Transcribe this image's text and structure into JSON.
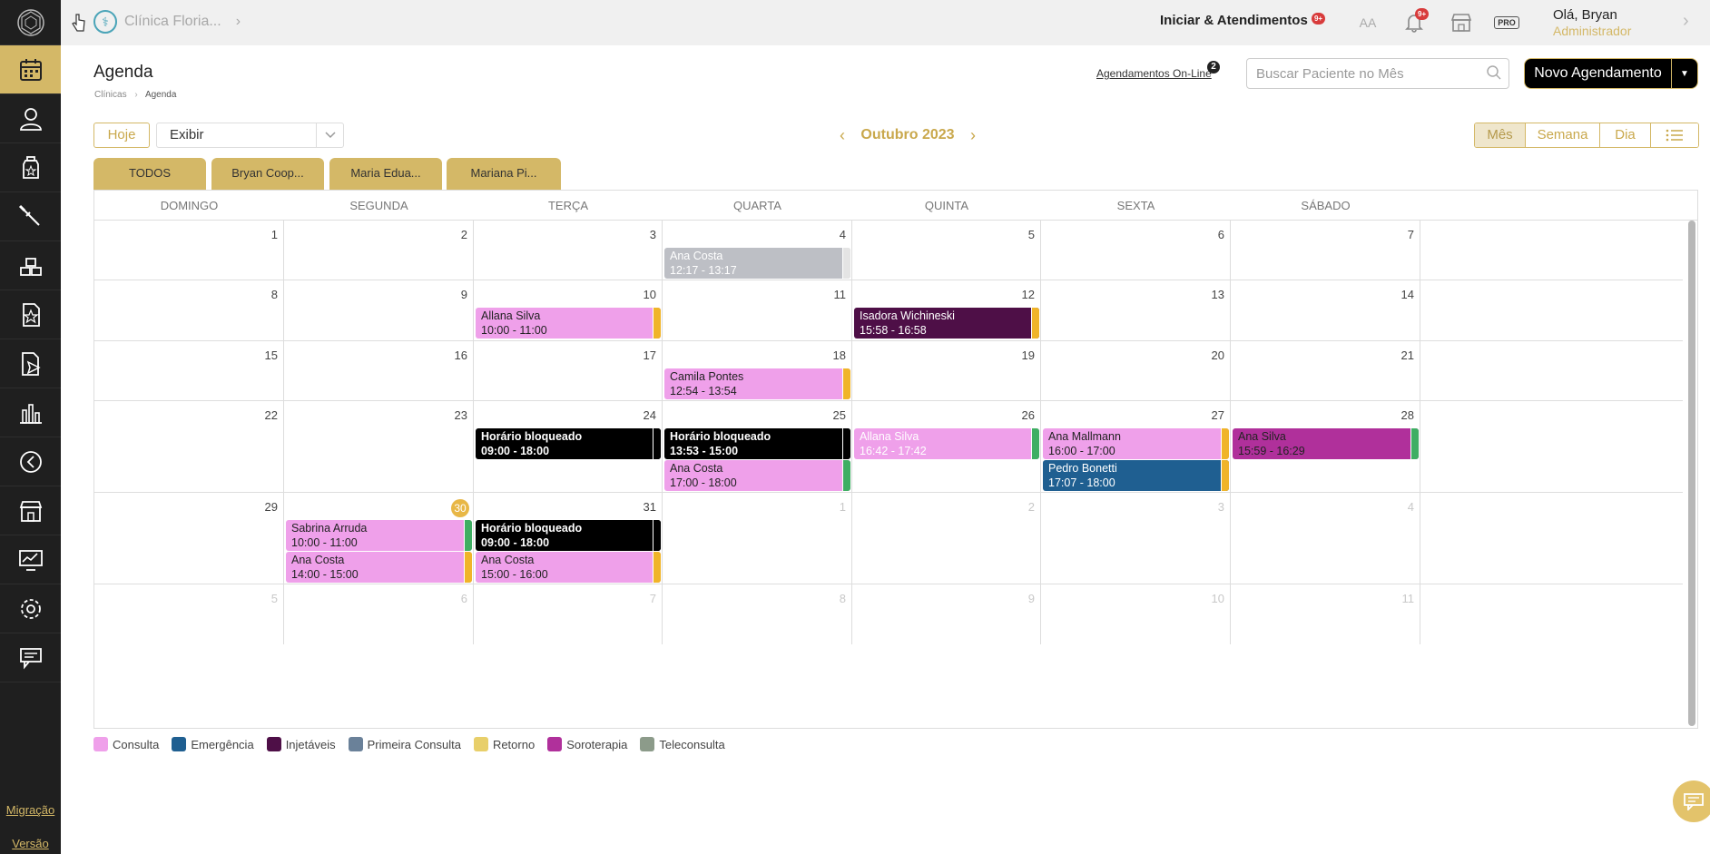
{
  "sidebar": {
    "items": [
      "calendar-icon",
      "user-icon",
      "bottle-icon",
      "tools-icon",
      "blocks-icon",
      "star-document-icon",
      "send-document-icon",
      "bar-chart-icon",
      "clock-arrow-icon",
      "store-icon",
      "monitor-chart-icon",
      "settings-icon",
      "chat-icon"
    ],
    "migracao": "Migração",
    "versao": "Versão"
  },
  "topbar": {
    "clinic": "Clínica Floria...",
    "iniciar": "Iniciar & Atendimentos",
    "iniciar_badge": "9+",
    "font_size_label": "AA",
    "bell_badge": "9+",
    "pro_label": "PRO",
    "user_name": "Olá, Bryan",
    "user_role": "Administrador"
  },
  "header": {
    "title": "Agenda",
    "breadcrumb_1": "Clínicas",
    "breadcrumb_sep": "›",
    "breadcrumb_2": "Agenda",
    "online_link": "Agendamentos On-Line",
    "online_badge": "2",
    "search_placeholder": "Buscar Paciente no Mês",
    "new_button": "Novo Agendamento"
  },
  "toolbar": {
    "today": "Hoje",
    "exibir": "Exibir",
    "month_title": "Outubro 2023",
    "views": [
      "Mês",
      "Semana",
      "Dia"
    ],
    "active_view": "Mês"
  },
  "tabs": [
    "TODOS",
    "Bryan Coop...",
    "Maria Edua...",
    "Mariana Pi..."
  ],
  "calendar": {
    "day_names": [
      "DOMINGO",
      "SEGUNDA",
      "TERÇA",
      "QUARTA",
      "QUINTA",
      "SEXTA",
      "SÁBADO"
    ],
    "weeks": [
      [
        {
          "n": "1"
        },
        {
          "n": "2"
        },
        {
          "n": "3"
        },
        {
          "n": "4"
        },
        {
          "n": "5"
        },
        {
          "n": "6"
        },
        {
          "n": "7"
        }
      ],
      [
        {
          "n": "8"
        },
        {
          "n": "9"
        },
        {
          "n": "10"
        },
        {
          "n": "11"
        },
        {
          "n": "12"
        },
        {
          "n": "13"
        },
        {
          "n": "14"
        }
      ],
      [
        {
          "n": "15"
        },
        {
          "n": "16"
        },
        {
          "n": "17"
        },
        {
          "n": "18"
        },
        {
          "n": "19"
        },
        {
          "n": "20"
        },
        {
          "n": "21"
        }
      ],
      [
        {
          "n": "22"
        },
        {
          "n": "23"
        },
        {
          "n": "24"
        },
        {
          "n": "25"
        },
        {
          "n": "26"
        },
        {
          "n": "27"
        },
        {
          "n": "28"
        }
      ],
      [
        {
          "n": "29"
        },
        {
          "n": "30",
          "today": true
        },
        {
          "n": "31"
        },
        {
          "n": "1",
          "other": true
        },
        {
          "n": "2",
          "other": true
        },
        {
          "n": "3",
          "other": true
        },
        {
          "n": "4",
          "other": true
        }
      ],
      [
        {
          "n": "5",
          "other": true
        },
        {
          "n": "6",
          "other": true
        },
        {
          "n": "7",
          "other": true
        },
        {
          "n": "8",
          "other": true
        },
        {
          "n": "9",
          "other": true
        },
        {
          "n": "10",
          "other": true
        },
        {
          "n": "11",
          "other": true
        }
      ]
    ],
    "events": [
      {
        "week": 0,
        "day": 3,
        "slot": 0,
        "name": "Ana Costa",
        "time": "12:17 - 13:17",
        "bg": "#bdbfc5",
        "fg": "#ffffff",
        "stripe": "#e4e4e4"
      },
      {
        "week": 1,
        "day": 2,
        "slot": 0,
        "name": "Allana Silva",
        "time": "10:00 - 11:00",
        "bg": "#efa0ea",
        "fg": "#222222",
        "stripe": "#f0b429"
      },
      {
        "week": 1,
        "day": 4,
        "slot": 0,
        "name": "Isadora Wichineski",
        "time": "15:58 - 16:58",
        "bg": "#4e0f47",
        "fg": "#ffffff",
        "stripe": "#f0b429"
      },
      {
        "week": 2,
        "day": 3,
        "slot": 0,
        "name": "Camila Pontes",
        "time": "12:54 - 13:54",
        "bg": "#efa0ea",
        "fg": "#222222",
        "stripe": "#f0b429"
      },
      {
        "week": 3,
        "day": 2,
        "slot": 0,
        "name": "Horário bloqueado",
        "time": "09:00 - 18:00",
        "bg": "#000000",
        "fg": "#ffffff",
        "stripe": "#000000",
        "bold": true
      },
      {
        "week": 3,
        "day": 3,
        "slot": 0,
        "name": "Horário bloqueado",
        "time": "13:53 - 15:00",
        "bg": "#000000",
        "fg": "#ffffff",
        "stripe": "#000000",
        "bold": true
      },
      {
        "week": 3,
        "day": 3,
        "slot": 1,
        "name": "Ana Costa",
        "time": "17:00 - 18:00",
        "bg": "#efa0ea",
        "fg": "#222222",
        "stripe": "#3fae63"
      },
      {
        "week": 3,
        "day": 4,
        "slot": 0,
        "name": "Allana Silva",
        "time": "16:42 - 17:42",
        "bg": "#efa0ea",
        "fg": "#ffffff",
        "stripe": "#3fae63"
      },
      {
        "week": 3,
        "day": 5,
        "slot": 0,
        "name": "Ana Mallmann",
        "time": "16:00 - 17:00",
        "bg": "#efa0ea",
        "fg": "#222222",
        "stripe": "#f0b429"
      },
      {
        "week": 3,
        "day": 5,
        "slot": 1,
        "name": "Pedro Bonetti",
        "time": "17:07 - 18:00",
        "bg": "#1f5f91",
        "fg": "#ffffff",
        "stripe": "#f0b429"
      },
      {
        "week": 3,
        "day": 6,
        "slot": 0,
        "name": "Ana Silva",
        "time": "15:59 - 16:29",
        "bg": "#b0309b",
        "fg": "#222222",
        "stripe": "#3fae63"
      },
      {
        "week": 4,
        "day": 1,
        "slot": 0,
        "name": "Sabrina Arruda",
        "time": "10:00 - 11:00",
        "bg": "#efa0ea",
        "fg": "#222222",
        "stripe": "#3fae63"
      },
      {
        "week": 4,
        "day": 1,
        "slot": 1,
        "name": "Ana Costa",
        "time": "14:00 - 15:00",
        "bg": "#efa0ea",
        "fg": "#222222",
        "stripe": "#f0b429"
      },
      {
        "week": 4,
        "day": 2,
        "slot": 0,
        "name": "Horário bloqueado",
        "time": "09:00 - 18:00",
        "bg": "#000000",
        "fg": "#ffffff",
        "stripe": "#000000",
        "bold": true
      },
      {
        "week": 4,
        "day": 2,
        "slot": 1,
        "name": "Ana Costa",
        "time": "15:00 - 16:00",
        "bg": "#efa0ea",
        "fg": "#222222",
        "stripe": "#f0b429"
      }
    ]
  },
  "legend": [
    {
      "label": "Consulta",
      "color": "#efa0ea"
    },
    {
      "label": "Emergência",
      "color": "#1f5f91"
    },
    {
      "label": "Injetáveis",
      "color": "#4e0f47"
    },
    {
      "label": "Primeira Consulta",
      "color": "#6a8199"
    },
    {
      "label": "Retorno",
      "color": "#e8cf6a"
    },
    {
      "label": "Soroterapia",
      "color": "#b0309b"
    },
    {
      "label": "Teleconsulta",
      "color": "#8c9b8a"
    }
  ],
  "colors": {
    "accent": "#d4b867",
    "sidebar": "#1f1f1f",
    "today": "#e8b746"
  }
}
